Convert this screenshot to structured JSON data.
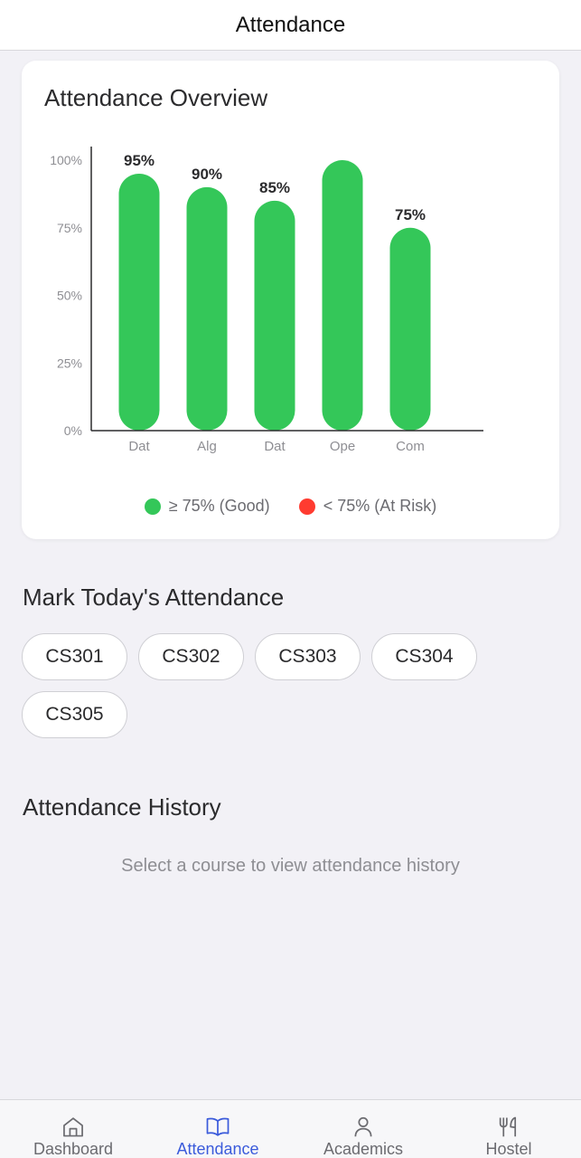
{
  "header": {
    "title": "Attendance"
  },
  "overview": {
    "title": "Attendance Overview",
    "legend": [
      {
        "label": "≥ 75% (Good)",
        "color": "#34c759"
      },
      {
        "label": "< 75% (At Risk)",
        "color": "#ff3b30"
      }
    ]
  },
  "chart_data": {
    "type": "bar",
    "categories": [
      "Dat",
      "Alg",
      "Dat",
      "Ope",
      "Com"
    ],
    "values": [
      95,
      90,
      85,
      100,
      75
    ],
    "value_labels": [
      "95%",
      "90%",
      "85%",
      "",
      "75%"
    ],
    "yticks": [
      "0%",
      "25%",
      "50%",
      "75%",
      "100%"
    ],
    "ylim": [
      0,
      100
    ],
    "bar_color": "#34c759",
    "title": "",
    "xlabel": "",
    "ylabel": ""
  },
  "mark": {
    "title": "Mark Today's Attendance",
    "courses": [
      "CS301",
      "CS302",
      "CS303",
      "CS304",
      "CS305"
    ]
  },
  "history": {
    "title": "Attendance History",
    "empty_text": "Select a course to view attendance history"
  },
  "tabs": [
    {
      "label": "Dashboard",
      "icon": "home-icon",
      "active": false
    },
    {
      "label": "Attendance",
      "icon": "book-icon",
      "active": true
    },
    {
      "label": "Academics",
      "icon": "person-icon",
      "active": false
    },
    {
      "label": "Hostel",
      "icon": "fork-knife-icon",
      "active": false
    }
  ],
  "colors": {
    "active_tab": "#3b5bdb",
    "inactive_tab": "#6b6b70",
    "good": "#34c759",
    "risk": "#ff3b30"
  }
}
